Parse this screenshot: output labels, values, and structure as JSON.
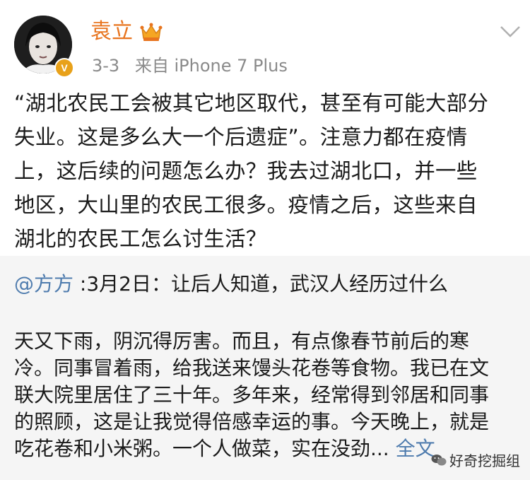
{
  "header": {
    "username": "袁立",
    "date": "3-3",
    "source_prefix": "来自",
    "device": "iPhone 7 Plus",
    "badge_icon": "crown-icon",
    "verified_label": "V",
    "chevron_icon": "chevron-down-icon"
  },
  "post": {
    "lines": [
      "“湖北农民工会被其它地区取代，甚至有可能大部分",
      "失业。这是多么大一个后遗症”。注意力都在疫情",
      "上，这后续的问题怎么办？我去过湖北口，并一些",
      "地区，大山里的农民工很多。疫情之后，这些来自",
      "湖北的农民工怎么讨生活？"
    ]
  },
  "repost": {
    "mention": "@方方",
    "title": " :3月2日：让后人知道，武汉人经历过什么",
    "lines": [
      "天又下雨，阴沉得厉害。而且，有点像春节前后的寒",
      "冷。同事冒着雨，给我送来馒头花卷等食物。我已在文",
      "联大院里居住了三十年。多年来，经常得到邻居和同事",
      "的照顾，这是让我觉得倍感幸运的事。今天晚上，就是",
      "吃花卷和小米粥。一个人做菜，实在没劲..."
    ],
    "full_text_link": "全文"
  },
  "watermark": {
    "text": "好奇挖掘组",
    "icon": "wechat-icon"
  },
  "colors": {
    "username": "#e8741e",
    "link": "#4f7cae",
    "meta": "#8a8a8a",
    "repost_bg": "#f5f5f5"
  }
}
